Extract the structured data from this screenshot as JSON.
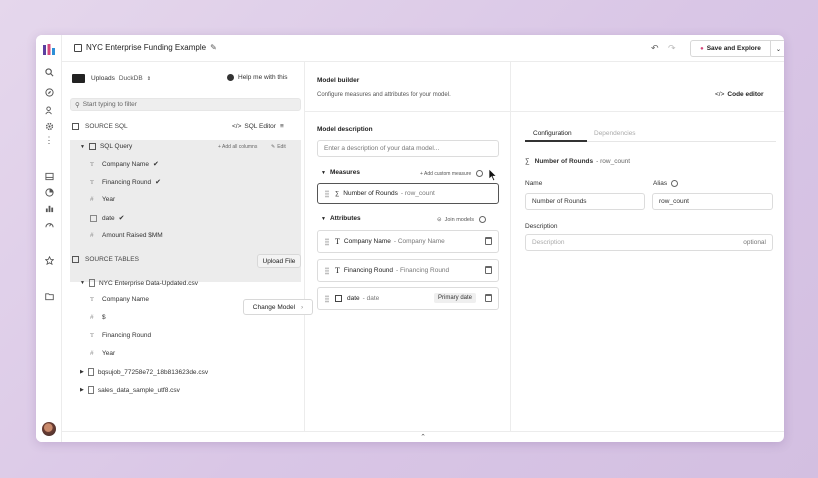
{
  "window": {
    "title": "NYC Enterprise Funding Example",
    "save_button": "Save and Explore"
  },
  "left": {
    "uploads_label": "Uploads",
    "db_label": "DuckDB",
    "help_link": "Help me with this",
    "filter_placeholder": "Start typing to filter",
    "source_sql_label": "SOURCE SQL",
    "sql_editor_label": "SQL Editor",
    "sql_query_label": "SQL Query",
    "add_all_columns": "+ Add all columns",
    "edit_label": "Edit",
    "sql_columns": [
      {
        "name": "Company Name",
        "checked": true
      },
      {
        "name": "Financing Round",
        "checked": true
      },
      {
        "name": "Year",
        "checked": false
      },
      {
        "name": "date",
        "checked": true
      },
      {
        "name": "Amount Raised $MM",
        "checked": false
      }
    ],
    "source_tables_label": "SOURCE TABLES",
    "upload_file_button": "Upload File",
    "tables": [
      {
        "name": "NYC Enterprise Data-Updated.csv"
      },
      {
        "name": "bqsujob_77258e72_18b813623de.csv"
      },
      {
        "name": "sales_data_sample_utf8.csv"
      }
    ],
    "table_columns": [
      "Company Name",
      "$",
      "Financing Round",
      "Year"
    ],
    "change_model_button": "Change Model"
  },
  "middle": {
    "model_builder_title": "Model builder",
    "model_builder_subtitle": "Configure measures and attributes for your model.",
    "model_description_label": "Model description",
    "description_placeholder": "Enter a description of your data model...",
    "measures_label": "Measures",
    "add_custom_measure": "+ Add custom measure",
    "measure": {
      "name": "Number of Rounds",
      "alias": "- row_count"
    },
    "attributes_label": "Attributes",
    "join_models": "Join models",
    "attributes": [
      {
        "name": "Company Name",
        "sub": "- Company Name"
      },
      {
        "name": "Financing Round",
        "sub": "- Financing Round"
      },
      {
        "name": "date",
        "sub": "- date",
        "badge": "Primary date"
      }
    ]
  },
  "right": {
    "code_editor": "Code editor",
    "tabs": [
      "Configuration",
      "Dependencies"
    ],
    "heading_name": "Number of Rounds",
    "heading_sub": "- row_count",
    "name_label": "Name",
    "name_value": "Number of Rounds",
    "alias_label": "Alias",
    "alias_value": "row_count",
    "description_label": "Description",
    "description_placeholder": "Description",
    "optional_label": "optional"
  }
}
